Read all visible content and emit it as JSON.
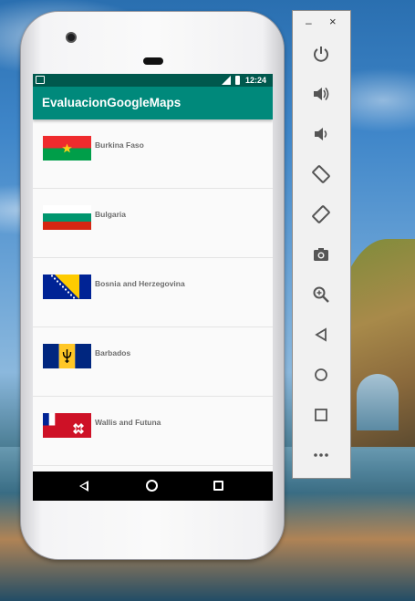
{
  "app": {
    "title": "EvaluacionGoogleMaps",
    "status_time": "12:24"
  },
  "countries": [
    {
      "name": "Burkina Faso",
      "flag": "burkina-faso-flag"
    },
    {
      "name": "Bulgaria",
      "flag": "bulgaria-flag"
    },
    {
      "name": "Bosnia and Herzegovina",
      "flag": "bosnia-herzegovina-flag"
    },
    {
      "name": "Barbados",
      "flag": "barbados-flag"
    },
    {
      "name": "Wallis and Futuna",
      "flag": "wallis-futuna-flag"
    }
  ],
  "nav": {
    "back": "back-icon",
    "home": "home-icon",
    "recent": "recent-apps-icon"
  },
  "emulator_toolbar": {
    "minimize": "–",
    "close": "×",
    "buttons": [
      "power-icon",
      "volume-up-icon",
      "volume-down-icon",
      "rotate-left-icon",
      "rotate-right-icon",
      "camera-icon",
      "zoom-icon",
      "back-icon",
      "home-icon",
      "overview-icon",
      "more-icon"
    ]
  },
  "colors": {
    "app_bar": "#00897b",
    "status_bar": "#00584d"
  }
}
